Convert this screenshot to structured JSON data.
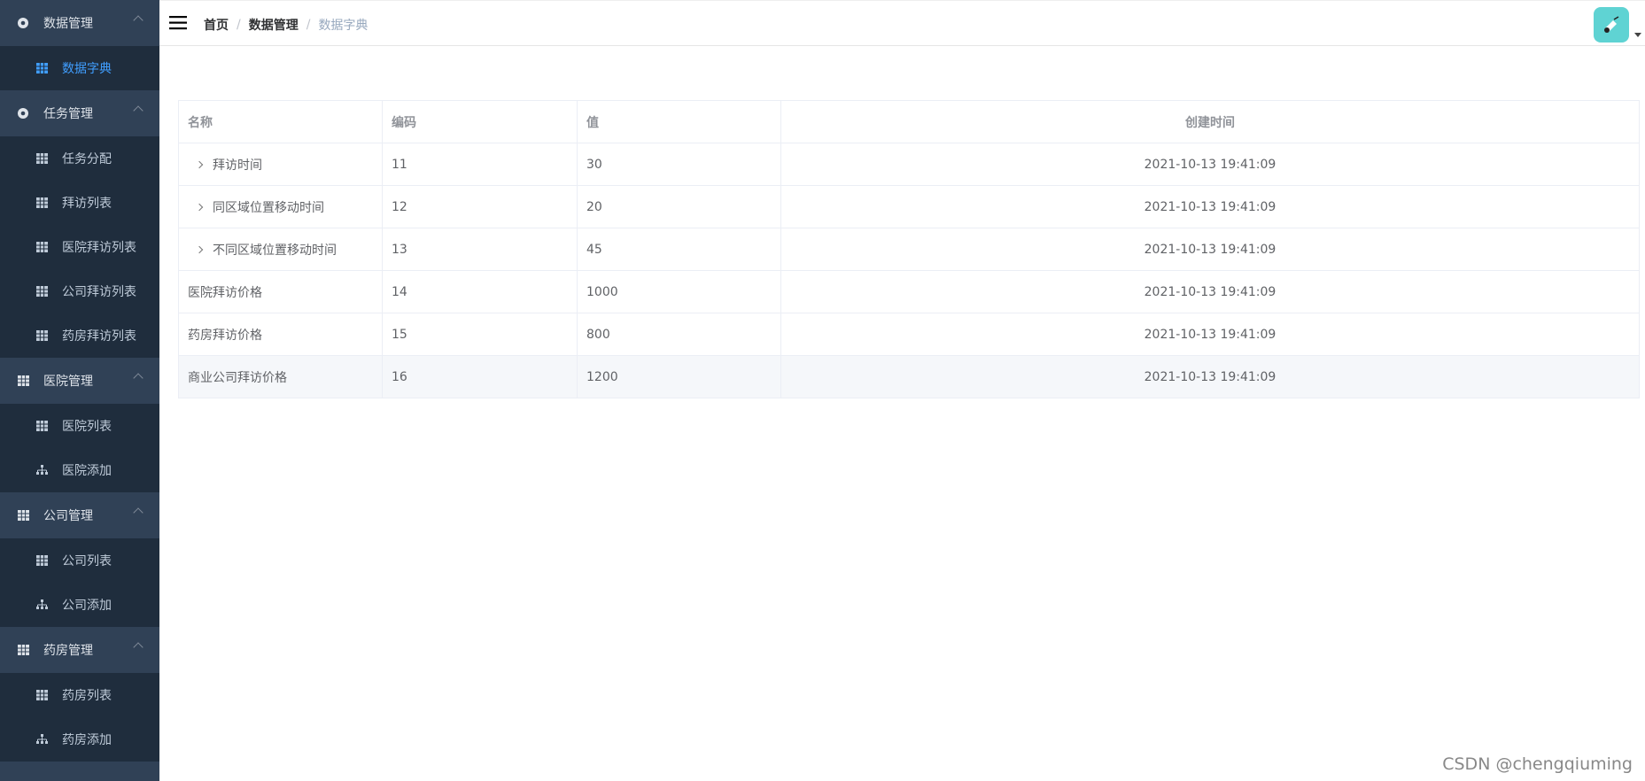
{
  "sidebar": {
    "groups": [
      {
        "label": "数据管理",
        "icon": "gear-icon",
        "items": [
          {
            "label": "数据字典",
            "icon": "table-icon",
            "active": true
          }
        ]
      },
      {
        "label": "任务管理",
        "icon": "gear-icon",
        "items": [
          {
            "label": "任务分配",
            "icon": "table-icon"
          },
          {
            "label": "拜访列表",
            "icon": "table-icon"
          },
          {
            "label": "医院拜访列表",
            "icon": "table-icon"
          },
          {
            "label": "公司拜访列表",
            "icon": "table-icon"
          },
          {
            "label": "药房拜访列表",
            "icon": "table-icon"
          }
        ]
      },
      {
        "label": "医院管理",
        "icon": "table-icon",
        "items": [
          {
            "label": "医院列表",
            "icon": "table-icon"
          },
          {
            "label": "医院添加",
            "icon": "tree-icon"
          }
        ]
      },
      {
        "label": "公司管理",
        "icon": "table-icon",
        "items": [
          {
            "label": "公司列表",
            "icon": "table-icon"
          },
          {
            "label": "公司添加",
            "icon": "tree-icon"
          }
        ]
      },
      {
        "label": "药房管理",
        "icon": "table-icon",
        "items": [
          {
            "label": "药房列表",
            "icon": "table-icon"
          },
          {
            "label": "药房添加",
            "icon": "tree-icon"
          }
        ]
      }
    ]
  },
  "navbar": {
    "breadcrumb": [
      "首页",
      "数据管理",
      "数据字典"
    ]
  },
  "table": {
    "headers": [
      "名称",
      "编码",
      "值",
      "创建时间"
    ],
    "rows": [
      {
        "name": "拜访时间",
        "code": "11",
        "value": "30",
        "created": "2021-10-13 19:41:09",
        "expandable": true
      },
      {
        "name": "同区域位置移动时间",
        "code": "12",
        "value": "20",
        "created": "2021-10-13 19:41:09",
        "expandable": true
      },
      {
        "name": "不同区域位置移动时间",
        "code": "13",
        "value": "45",
        "created": "2021-10-13 19:41:09",
        "expandable": true
      },
      {
        "name": "医院拜访价格",
        "code": "14",
        "value": "1000",
        "created": "2021-10-13 19:41:09",
        "expandable": false
      },
      {
        "name": "药房拜访价格",
        "code": "15",
        "value": "800",
        "created": "2021-10-13 19:41:09",
        "expandable": false
      },
      {
        "name": "商业公司拜访价格",
        "code": "16",
        "value": "1200",
        "created": "2021-10-13 19:41:09",
        "expandable": false
      }
    ]
  },
  "watermark": "CSDN @chengqiuming",
  "colors": {
    "sidebar_bg": "#304156",
    "submenu_bg": "#1f2d3d",
    "active_text": "#409eff",
    "avatar_bg": "#5fd3d3"
  }
}
